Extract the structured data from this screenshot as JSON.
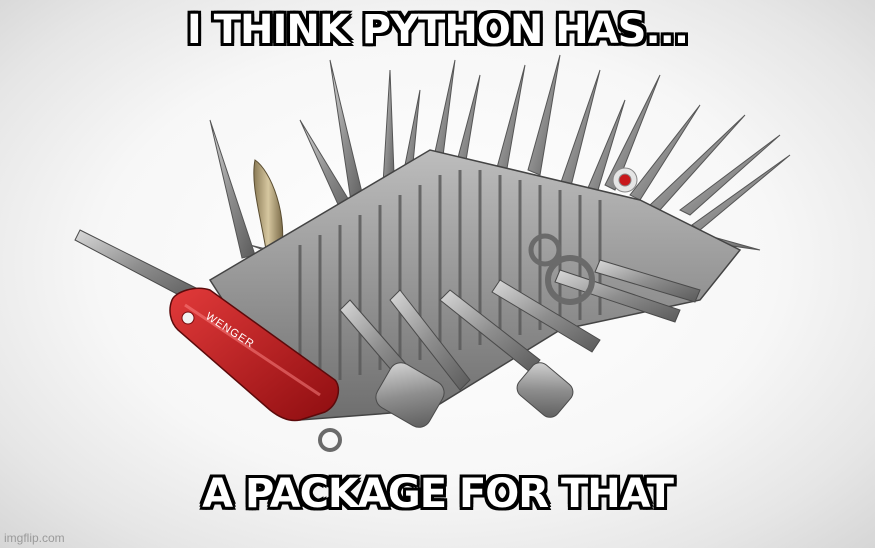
{
  "meme": {
    "top_text": "I THINK PYTHON HAS...",
    "bottom_text": "A PACKAGE FOR THAT",
    "brand_on_knife": "WENGER",
    "watermark": "imgflip.com"
  },
  "colors": {
    "caption_fill": "#ffffff",
    "caption_outline": "#000000",
    "knife_red": "#c8171b",
    "steel": "#9a9a9a"
  }
}
